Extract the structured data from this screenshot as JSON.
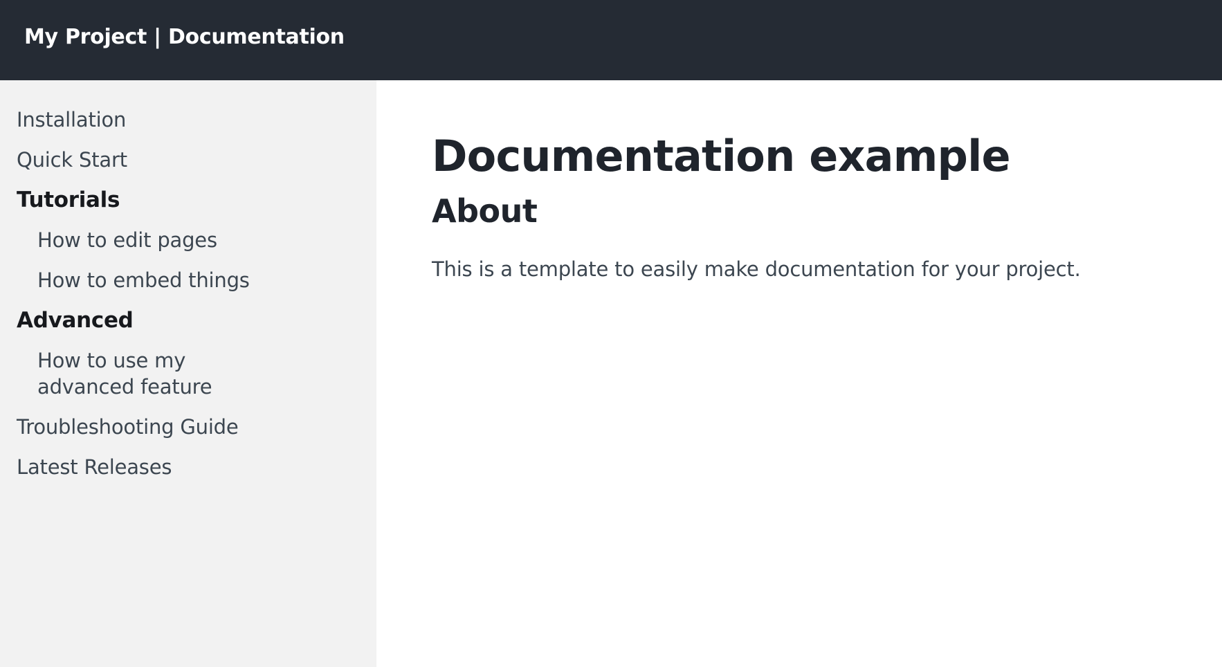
{
  "header": {
    "site_title": "My Project | Documentation"
  },
  "sidebar": {
    "items": [
      {
        "label": "Installation"
      },
      {
        "label": "Quick Start"
      }
    ],
    "sections": [
      {
        "title": "Tutorials",
        "items": [
          {
            "label": "How to edit pages"
          },
          {
            "label": "How to embed things"
          }
        ]
      },
      {
        "title": "Advanced",
        "items": [
          {
            "label": "How to use my advanced feature"
          }
        ]
      }
    ],
    "footer_items": [
      {
        "label": "Troubleshooting Guide"
      },
      {
        "label": "Latest Releases"
      }
    ]
  },
  "main": {
    "title": "Documentation example",
    "section_heading": "About",
    "paragraph": "This is a template to easily make documentation for your project."
  },
  "colors": {
    "header_bg": "#252b34",
    "sidebar_bg": "#f2f2f2",
    "text": "#3c4650",
    "heading": "#1f242c"
  }
}
